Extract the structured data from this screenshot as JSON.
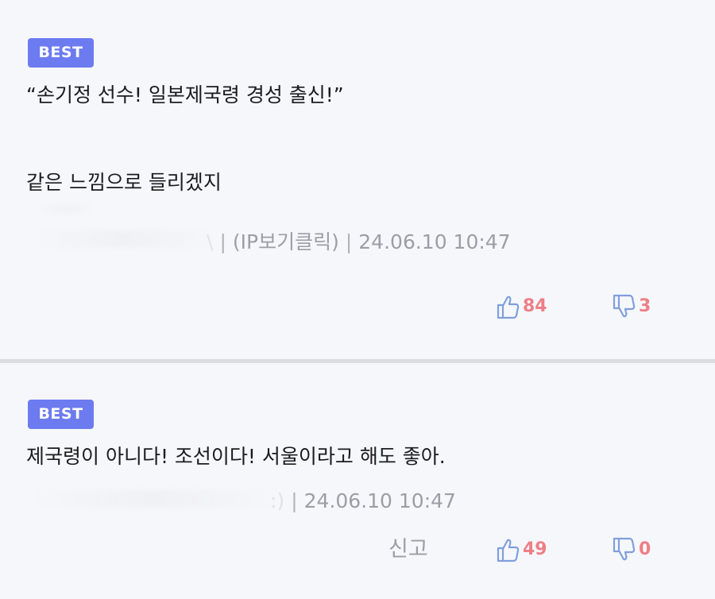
{
  "comments": [
    {
      "badge": "BEST",
      "line1": "“손기정 선수! 일본제국령 경성 출신!”",
      "line2": "같은 느낌으로 들리겠지",
      "meta_name_tail": "\\",
      "meta_ip": "(IP보기클릭)",
      "meta_time": "24.06.10 10:47",
      "likes": "84",
      "dislikes": "3"
    },
    {
      "badge": "BEST",
      "line1": "제국령이 아니다! 조선이다! 서울이라고 해도 좋아.",
      "meta_name_tail": ":)",
      "meta_time": "24.06.10 10:47",
      "report": "신고",
      "likes": "49",
      "dislikes": "0"
    }
  ],
  "colors": {
    "badge": "#6c7bf0",
    "count": "#ee7f86",
    "icon": "#7f9fdd",
    "meta": "#9c9ea6",
    "background": "#f6f7fb"
  },
  "icons": {
    "like": "thumbs-up-icon",
    "dislike": "thumbs-down-icon"
  }
}
